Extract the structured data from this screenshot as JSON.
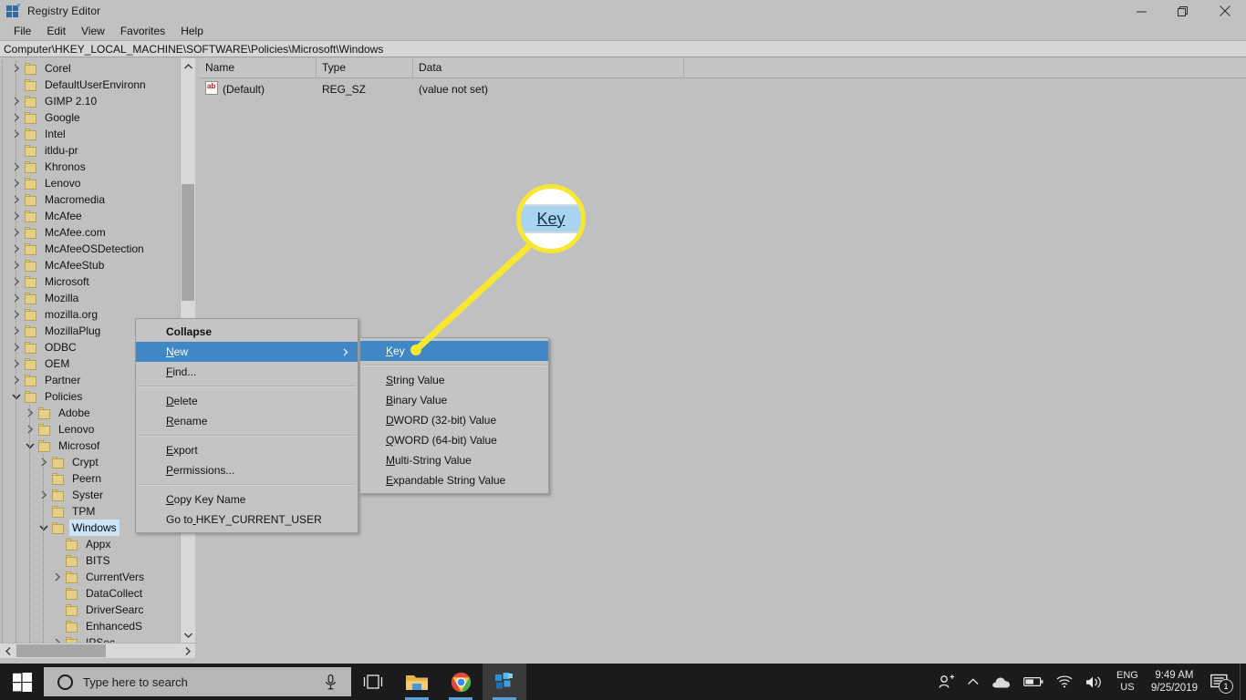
{
  "window": {
    "title": "Registry Editor",
    "icon": "registry-editor-icon",
    "controls": {
      "minimize": "minimize-icon",
      "restore": "restore-icon",
      "close": "close-icon"
    }
  },
  "menubar": {
    "items": [
      "File",
      "Edit",
      "View",
      "Favorites",
      "Help"
    ]
  },
  "address": {
    "path": "Computer\\HKEY_LOCAL_MACHINE\\SOFTWARE\\Policies\\Microsoft\\Windows"
  },
  "tree": {
    "items": [
      {
        "label": "Corel",
        "indent": 3,
        "expander": "collapsed"
      },
      {
        "label": "DefaultUserEnvironn",
        "indent": 3,
        "expander": "none"
      },
      {
        "label": "GIMP 2.10",
        "indent": 3,
        "expander": "collapsed"
      },
      {
        "label": "Google",
        "indent": 3,
        "expander": "collapsed"
      },
      {
        "label": "Intel",
        "indent": 3,
        "expander": "collapsed"
      },
      {
        "label": "itldu-pr",
        "indent": 3,
        "expander": "none"
      },
      {
        "label": "Khronos",
        "indent": 3,
        "expander": "collapsed"
      },
      {
        "label": "Lenovo",
        "indent": 3,
        "expander": "collapsed"
      },
      {
        "label": "Macromedia",
        "indent": 3,
        "expander": "collapsed"
      },
      {
        "label": "McAfee",
        "indent": 3,
        "expander": "collapsed"
      },
      {
        "label": "McAfee.com",
        "indent": 3,
        "expander": "collapsed"
      },
      {
        "label": "McAfeeOSDetection",
        "indent": 3,
        "expander": "collapsed"
      },
      {
        "label": "McAfeeStub",
        "indent": 3,
        "expander": "collapsed"
      },
      {
        "label": "Microsoft",
        "indent": 3,
        "expander": "collapsed"
      },
      {
        "label": "Mozilla",
        "indent": 3,
        "expander": "collapsed"
      },
      {
        "label": "mozilla.org",
        "indent": 3,
        "expander": "collapsed"
      },
      {
        "label": "MozillaPlug",
        "indent": 3,
        "expander": "collapsed"
      },
      {
        "label": "ODBC",
        "indent": 3,
        "expander": "collapsed"
      },
      {
        "label": "OEM",
        "indent": 3,
        "expander": "collapsed"
      },
      {
        "label": "Partner",
        "indent": 3,
        "expander": "collapsed"
      },
      {
        "label": "Policies",
        "indent": 3,
        "expander": "expanded"
      },
      {
        "label": "Adobe",
        "indent": 4,
        "expander": "collapsed"
      },
      {
        "label": "Lenovo",
        "indent": 4,
        "expander": "collapsed"
      },
      {
        "label": "Microsof",
        "indent": 4,
        "expander": "expanded"
      },
      {
        "label": "Crypt",
        "indent": 5,
        "expander": "collapsed"
      },
      {
        "label": "Peern",
        "indent": 5,
        "expander": "none"
      },
      {
        "label": "Syster",
        "indent": 5,
        "expander": "collapsed"
      },
      {
        "label": "TPM",
        "indent": 5,
        "expander": "none"
      },
      {
        "label": "Windows",
        "indent": 5,
        "expander": "expanded",
        "selected": true
      },
      {
        "label": "Appx",
        "indent": 6,
        "expander": "none"
      },
      {
        "label": "BITS",
        "indent": 6,
        "expander": "none"
      },
      {
        "label": "CurrentVers",
        "indent": 6,
        "expander": "collapsed"
      },
      {
        "label": "DataCollect",
        "indent": 6,
        "expander": "none"
      },
      {
        "label": "DriverSearc",
        "indent": 6,
        "expander": "none"
      },
      {
        "label": "EnhancedS",
        "indent": 6,
        "expander": "none"
      },
      {
        "label": "IPSec",
        "indent": 6,
        "expander": "collapsed"
      }
    ]
  },
  "values": {
    "columns": [
      "Name",
      "Type",
      "Data"
    ],
    "rows": [
      {
        "icon": "string-value-icon",
        "name": "(Default)",
        "type": "REG_SZ",
        "data": "(value not set)"
      }
    ]
  },
  "context_menu": {
    "items": [
      {
        "label": "Collapse",
        "bold": true,
        "accel_index": -1
      },
      {
        "label": "New",
        "highlighted": true,
        "submenu": true,
        "accel_index": 0
      },
      {
        "label": "Find...",
        "accel_index": 0
      },
      {
        "separator": true
      },
      {
        "label": "Delete",
        "accel_index": 0
      },
      {
        "label": "Rename",
        "accel_index": 0
      },
      {
        "separator": true
      },
      {
        "label": "Export",
        "accel_index": 0
      },
      {
        "label": "Permissions...",
        "accel_index": 0
      },
      {
        "separator": true
      },
      {
        "label": "Copy Key Name",
        "accel_index": 0
      },
      {
        "label": "Go to HKEY_CURRENT_USER",
        "accel_index": 5
      }
    ]
  },
  "submenu": {
    "items": [
      {
        "label": "Key",
        "highlighted": true,
        "accel_index": 0
      },
      {
        "separator": true
      },
      {
        "label": "String Value",
        "accel_index": 0
      },
      {
        "label": "Binary Value",
        "accel_index": 0
      },
      {
        "label": "DWORD (32-bit) Value",
        "accel_index": 0
      },
      {
        "label": "QWORD (64-bit) Value",
        "accel_index": 0
      },
      {
        "label": "Multi-String Value",
        "accel_index": 0
      },
      {
        "label": "Expandable String Value",
        "accel_index": 0
      }
    ]
  },
  "callout": {
    "magnified_text": "Key",
    "highlight_color": "#f7e732",
    "band_color": "#a8d4f0"
  },
  "taskbar": {
    "start": "windows-start-icon",
    "search_placeholder": "Type here to search",
    "mic": "microphone-icon",
    "apps": [
      {
        "name": "task-view-icon",
        "active": false
      },
      {
        "name": "file-explorer-icon",
        "active": false,
        "running": true
      },
      {
        "name": "chrome-icon",
        "active": false,
        "running": true
      },
      {
        "name": "registry-editor-icon",
        "active": true,
        "running": true
      }
    ],
    "tray": {
      "people": "people-icon",
      "chevron": "show-hidden-icons-chevron",
      "onedrive": "onedrive-cloud-icon",
      "battery": "battery-icon",
      "network": "wifi-icon",
      "volume": "volume-icon",
      "language_line1": "ENG",
      "language_line2": "US",
      "time": "9:49 AM",
      "date": "9/25/2019",
      "notifications": "action-center-icon",
      "notification_count": "1"
    }
  }
}
